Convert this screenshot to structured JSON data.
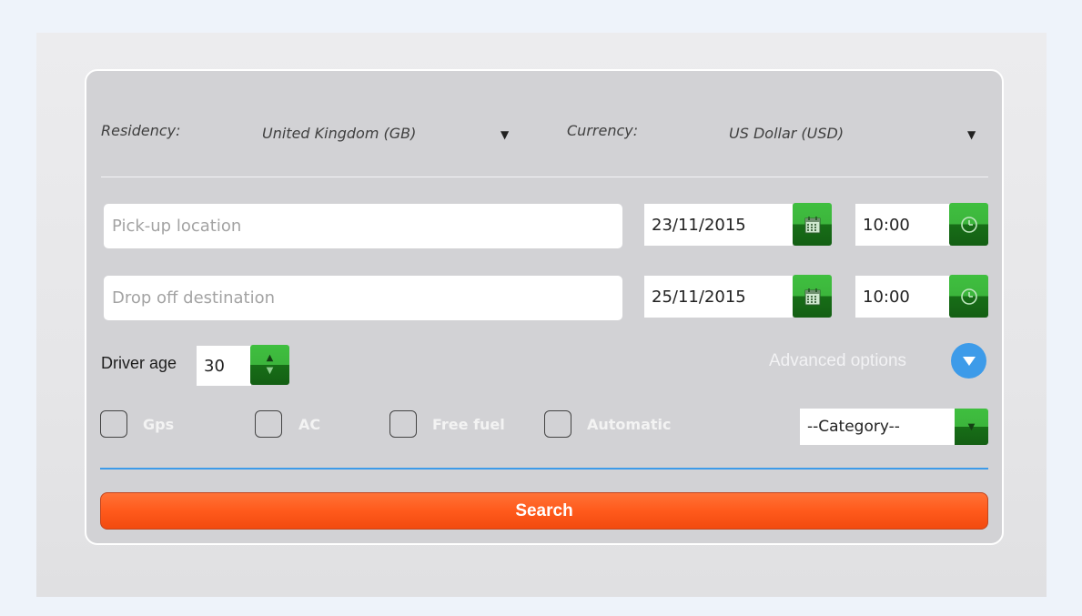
{
  "settings": {
    "residency_label": "Residency:",
    "residency_value": "United Kingdom (GB)",
    "currency_label": "Currency:",
    "currency_value": "US Dollar (USD)"
  },
  "pickup": {
    "placeholder": "Pick-up location",
    "date": "23/11/2015",
    "time": "10:00"
  },
  "dropoff": {
    "placeholder": "Drop off destination",
    "date": "25/11/2015",
    "time": "10:00"
  },
  "driver": {
    "label": "Driver age",
    "age": "30"
  },
  "advanced_label": "Advanced options",
  "checkboxes": [
    {
      "label": "Gps"
    },
    {
      "label": "AC"
    },
    {
      "label": "Free fuel"
    },
    {
      "label": "Automatic"
    }
  ],
  "category_value": "--Category--",
  "search_label": "Search",
  "colors": {
    "accent_green": "#3cb53c",
    "search_orange": "#ff5a1c",
    "info_blue": "#3d9be9"
  }
}
